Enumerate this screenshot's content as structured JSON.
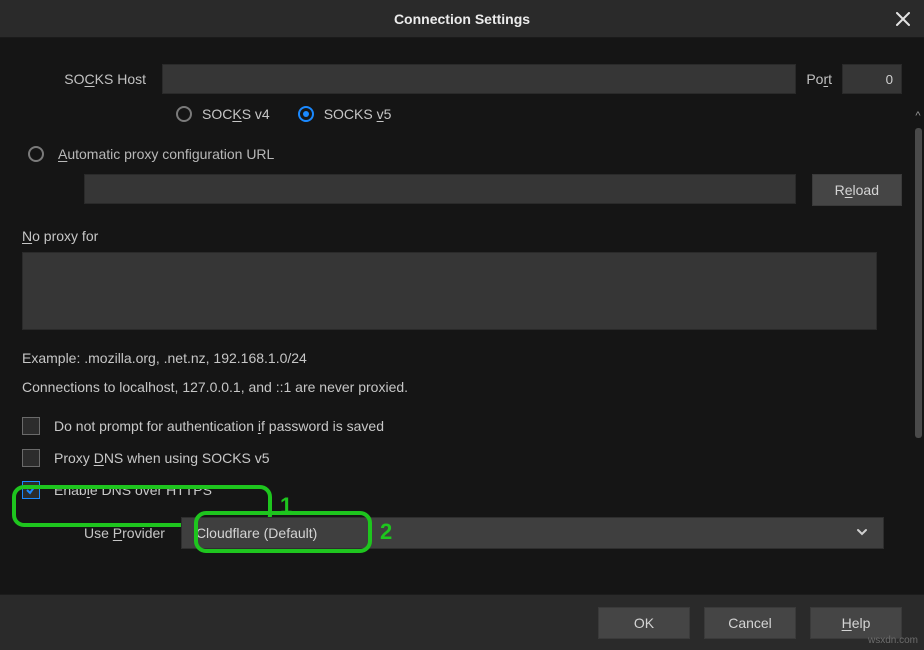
{
  "title": "Connection Settings",
  "socks": {
    "host_label": "SOCKS Host",
    "host_value": "",
    "port_label": "Port",
    "port_value": "0",
    "v4_label": "SOCKS v4",
    "v5_label": "SOCKS v5",
    "selected": "v5"
  },
  "pac": {
    "radio_label": "Automatic proxy configuration URL",
    "url_value": "",
    "reload_label": "Reload"
  },
  "noproxy": {
    "label": "No proxy for",
    "value": "",
    "example": "Example: .mozilla.org, .net.nz, 192.168.1.0/24",
    "note": "Connections to localhost, 127.0.0.1, and ::1 are never proxied."
  },
  "checks": {
    "no_prompt": "Do not prompt for authentication if password is saved",
    "proxy_dns": "Proxy DNS when using SOCKS v5",
    "doh": "Enable DNS over HTTPS"
  },
  "provider": {
    "label": "Use Provider",
    "selected": "Cloudflare (Default)"
  },
  "buttons": {
    "ok": "OK",
    "cancel": "Cancel",
    "help": "Help"
  },
  "annotations": {
    "one": "1",
    "two": "2"
  },
  "watermark": "wsxdn.com"
}
